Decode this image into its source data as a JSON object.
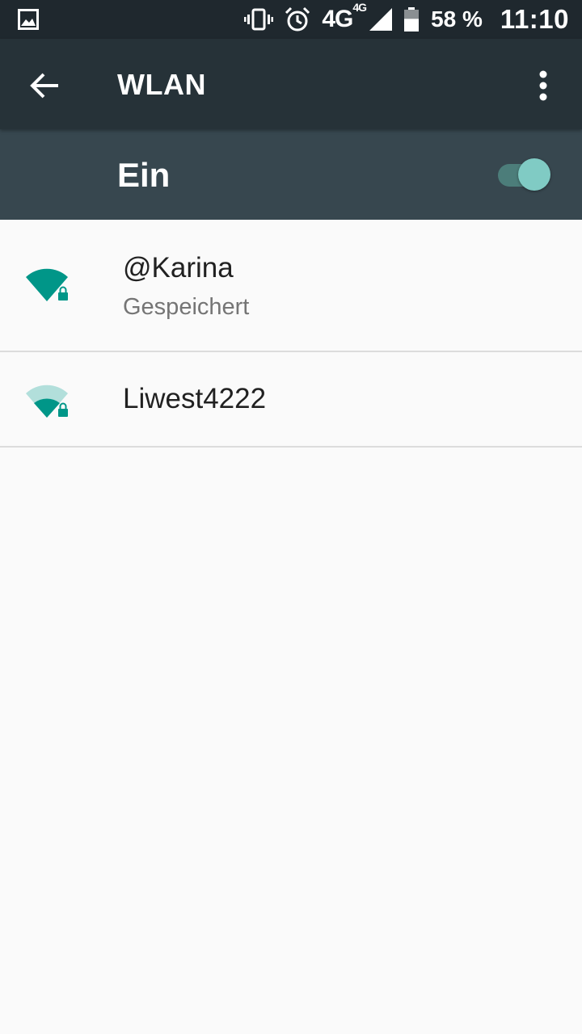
{
  "status_bar": {
    "network_label": "4G",
    "network_sup": "4G",
    "battery_percent": "58 %",
    "battery_level": 0.58,
    "time": "11:10",
    "icons": [
      "image-icon",
      "vibrate-icon",
      "alarm-icon",
      "signal-icon",
      "battery-icon"
    ]
  },
  "toolbar": {
    "title": "WLAN",
    "back_icon": "arrow-back-icon",
    "menu_icon": "more-vert-icon"
  },
  "switch_bar": {
    "label": "Ein",
    "enabled": true,
    "accent_color": "#80cbc4"
  },
  "networks": [
    {
      "name": "@Karina",
      "status": "Gespeichert",
      "signal": "full",
      "secured": true
    },
    {
      "name": "Liwest4222",
      "status": "",
      "signal": "medium",
      "secured": true
    }
  ],
  "colors": {
    "wifi_teal": "#009688",
    "wifi_teal_light": "#b2dfdb",
    "toolbar": "#263238",
    "switch_bar": "#37474f",
    "status_bar": "#1f282e"
  }
}
